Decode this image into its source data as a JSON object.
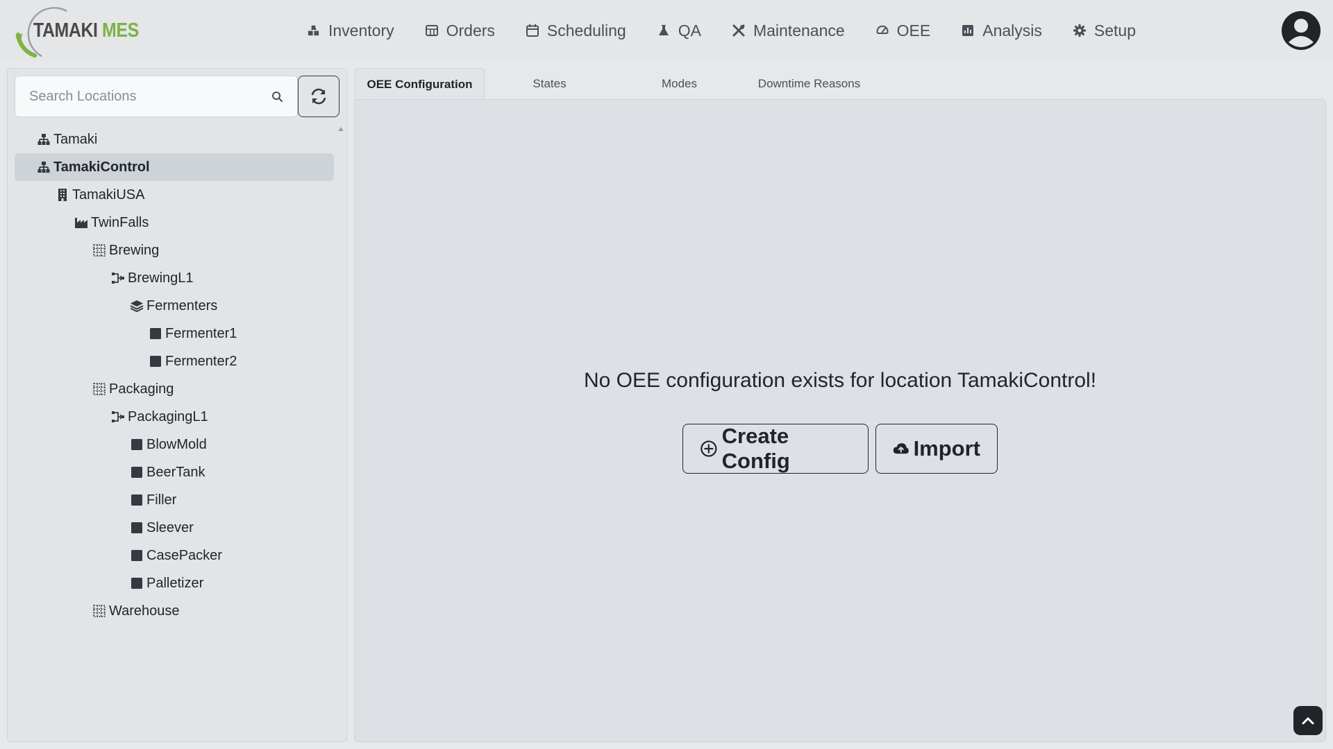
{
  "app": {
    "logo_text_primary": "TAMAKI",
    "logo_text_accent": "MES",
    "brand_color": "#7cb342"
  },
  "nav": {
    "items": [
      {
        "label": "Inventory",
        "icon": "boxes-icon"
      },
      {
        "label": "Orders",
        "icon": "orders-icon"
      },
      {
        "label": "Scheduling",
        "icon": "calendar-icon"
      },
      {
        "label": "QA",
        "icon": "flask-icon"
      },
      {
        "label": "Maintenance",
        "icon": "tools-icon"
      },
      {
        "label": "OEE",
        "icon": "speedometer-icon"
      },
      {
        "label": "Analysis",
        "icon": "chart-icon"
      },
      {
        "label": "Setup",
        "icon": "gear-icon"
      }
    ],
    "user_icon": "user-circle-icon"
  },
  "sidebar": {
    "search_placeholder": "Search Locations",
    "refresh_icon": "refresh-icon",
    "tree": [
      {
        "label": "Tamaki",
        "level": 0,
        "icon": "enterprise-icon"
      },
      {
        "label": "TamakiControl",
        "level": 0,
        "icon": "enterprise-icon",
        "selected": true
      },
      {
        "label": "TamakiUSA",
        "level": 1,
        "icon": "building-icon"
      },
      {
        "label": "TwinFalls",
        "level": 2,
        "icon": "factory-icon"
      },
      {
        "label": "Brewing",
        "level": 3,
        "icon": "area-grid-icon"
      },
      {
        "label": "BrewingL1",
        "level": 4,
        "icon": "line-icon"
      },
      {
        "label": "Fermenters",
        "level": 5,
        "icon": "layers-icon"
      },
      {
        "label": "Fermenter1",
        "level": 6,
        "icon": "cell-square-icon"
      },
      {
        "label": "Fermenter2",
        "level": 6,
        "icon": "cell-square-icon"
      },
      {
        "label": "Packaging",
        "level": 3,
        "icon": "area-grid-icon"
      },
      {
        "label": "PackagingL1",
        "level": 4,
        "icon": "line-icon"
      },
      {
        "label": "BlowMold",
        "level": 5,
        "icon": "cell-square-icon"
      },
      {
        "label": "BeerTank",
        "level": 5,
        "icon": "cell-square-icon"
      },
      {
        "label": "Filler",
        "level": 5,
        "icon": "cell-square-icon"
      },
      {
        "label": "Sleever",
        "level": 5,
        "icon": "cell-square-icon"
      },
      {
        "label": "CasePacker",
        "level": 5,
        "icon": "cell-square-icon"
      },
      {
        "label": "Palletizer",
        "level": 5,
        "icon": "cell-square-icon"
      },
      {
        "label": "Warehouse",
        "level": 3,
        "icon": "area-grid-icon"
      }
    ]
  },
  "main": {
    "tabs": [
      {
        "label": "OEE Configuration",
        "active": true
      },
      {
        "label": "States",
        "active": false
      },
      {
        "label": "Modes",
        "active": false
      },
      {
        "label": "Downtime Reasons",
        "active": false
      }
    ],
    "empty_message": "No OEE configuration exists for location TamakiControl!",
    "create_button": "Create Config",
    "import_button": "Import"
  }
}
